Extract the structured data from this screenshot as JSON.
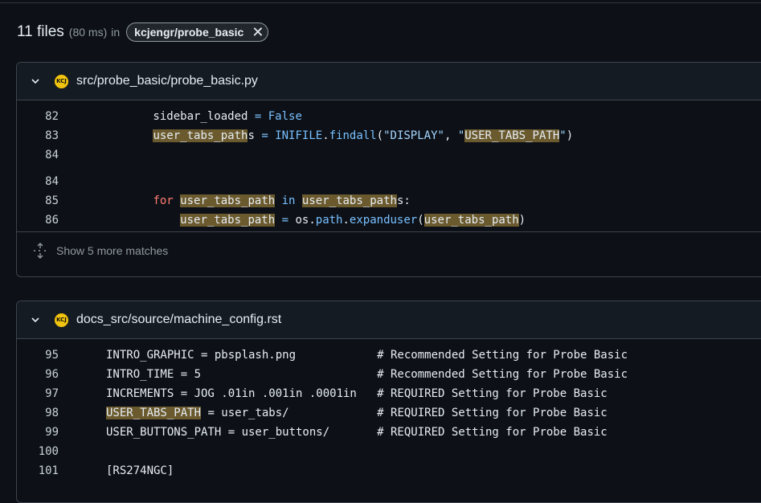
{
  "results": {
    "count_label": "11 files",
    "time_label": "(80 ms)",
    "in_label": "in",
    "repo_chip": "kcjengr/probe_basic",
    "chip_close_icon": "close-icon"
  },
  "files": [
    {
      "path": "src/probe_basic/probe_basic.py",
      "lang_icon_text": "KCJ",
      "more_matches_label": "Show 5 more matches",
      "lines": [
        {
          "num": "82",
          "text": "        sidebar_loaded = False"
        },
        {
          "num": "83",
          "text": "        user_tabs_paths = INIFILE.findall(\"DISPLAY\", \"USER_TABS_PATH\")"
        },
        {
          "num": "84",
          "text": ""
        },
        {
          "num": "84",
          "text": ""
        },
        {
          "num": "85",
          "text": "        for user_tabs_path in user_tabs_paths:"
        },
        {
          "num": "86",
          "text": "            user_tabs_path = os.path.expanduser(user_tabs_path)"
        }
      ]
    },
    {
      "path": "docs_src/source/machine_config.rst",
      "lang_icon_text": "KCJ",
      "lines": [
        {
          "num": "95",
          "text": "INTRO_GRAPHIC = pbsplash.png            # Recommended Setting for Probe Basic"
        },
        {
          "num": "96",
          "text": "INTRO_TIME = 5                          # Recommended Setting for Probe Basic"
        },
        {
          "num": "97",
          "text": "INCREMENTS = JOG .01in .001in .0001in   # REQUIRED Setting for Probe Basic"
        },
        {
          "num": "98",
          "text": "USER_TABS_PATH = user_tabs/             # REQUIRED Setting for Probe Basic"
        },
        {
          "num": "99",
          "text": "USER_BUTTONS_PATH = user_buttons/       # REQUIRED Setting for Probe Basic"
        },
        {
          "num": "100",
          "text": ""
        },
        {
          "num": "101",
          "text": "[RS274NGC]"
        }
      ]
    }
  ]
}
